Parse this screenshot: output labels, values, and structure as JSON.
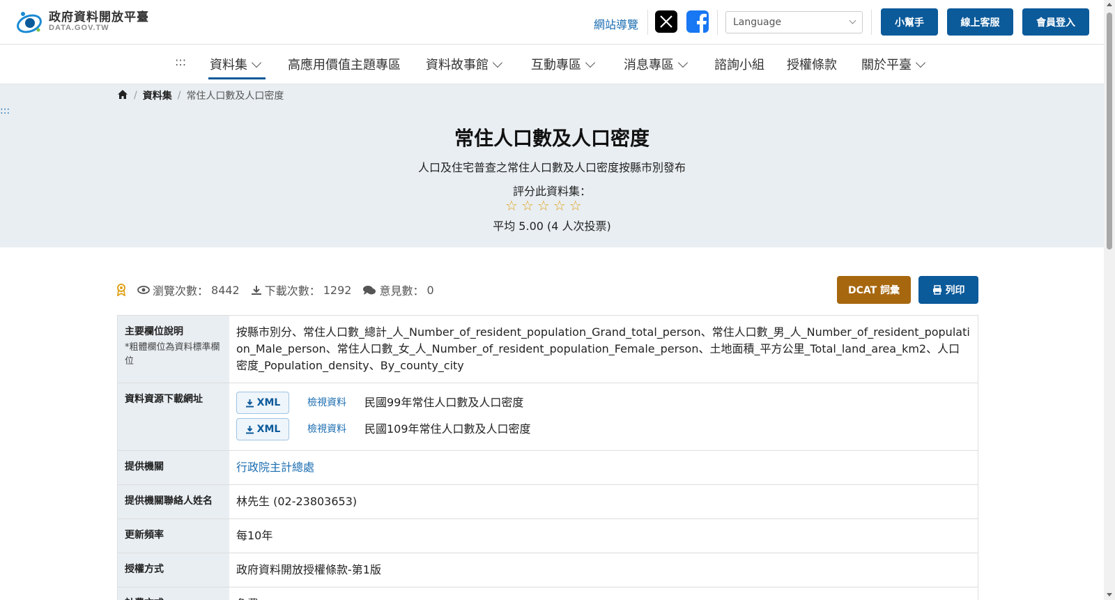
{
  "header": {
    "logo_title": "政府資料開放平臺",
    "logo_sub": "DATA.GOV.TW",
    "sitemap": "網站導覽",
    "language_placeholder": "Language",
    "helper": "小幫手",
    "support": "線上客服",
    "login": "會員登入"
  },
  "nav": {
    "menu_dots": ":::",
    "items": [
      {
        "label": "資料集"
      },
      {
        "label": "高應用價值主題專區"
      },
      {
        "label": "資料故事館"
      },
      {
        "label": "互動專區"
      },
      {
        "label": "消息專區"
      },
      {
        "label": "諮詢小組"
      },
      {
        "label": "授權條款"
      },
      {
        "label": "關於平臺"
      }
    ]
  },
  "breadcrumb": {
    "level1": "資料集",
    "current": "常住人口數及人口密度"
  },
  "side_dots": ":::",
  "dataset": {
    "title": "常住人口數及人口密度",
    "description": "人口及住宅普查之常住人口數及人口密度按縣市別發布",
    "rate_label": "評分此資料集：",
    "rating_stars": 5,
    "average": "平均 5.00 (4 人次投票)"
  },
  "stats": {
    "views_label": "瀏覽次數：",
    "views": "8442",
    "downloads_label": "下載次數：",
    "downloads": "1292",
    "comments_label": "意見數：",
    "comments": "0"
  },
  "actions": {
    "dcat": "DCAT 詞彙",
    "print": "列印"
  },
  "table": {
    "fields_label": "主要欄位說明",
    "fields_note": "*粗體欄位為資料標準欄位",
    "fields_value": "按縣市別分、常住人口數_總計_人_Number_of_resident_population_Grand_total_person、常住人口數_男_人_Number_of_resident_population_Male_person、常住人口數_女_人_Number_of_resident_population_Female_person、土地面積_平方公里_Total_land_area_km2、人口密度_Population_density、By_county_city",
    "resources_label": "資料資源下載網址",
    "resources": [
      {
        "format": "XML",
        "view": "檢視資料",
        "name": "民國99年常住人口數及人口密度"
      },
      {
        "format": "XML",
        "view": "檢視資料",
        "name": "民國109年常住人口數及人口密度"
      }
    ],
    "agency_label": "提供機關",
    "agency_value": "行政院主計總處",
    "contact_label": "提供機關聯絡人姓名",
    "contact_value": "林先生 (02-23803653)",
    "frequency_label": "更新頻率",
    "frequency_value": "每10年",
    "license_label": "授權方式",
    "license_value": "政府資料開放授權條款-第1版",
    "fee_label": "計費方式",
    "fee_value": "免費"
  },
  "colors": {
    "primary": "#0b5a9a",
    "dcat": "#a7670f",
    "hero_bg": "#e9eef2",
    "star": "#e0a21a"
  }
}
